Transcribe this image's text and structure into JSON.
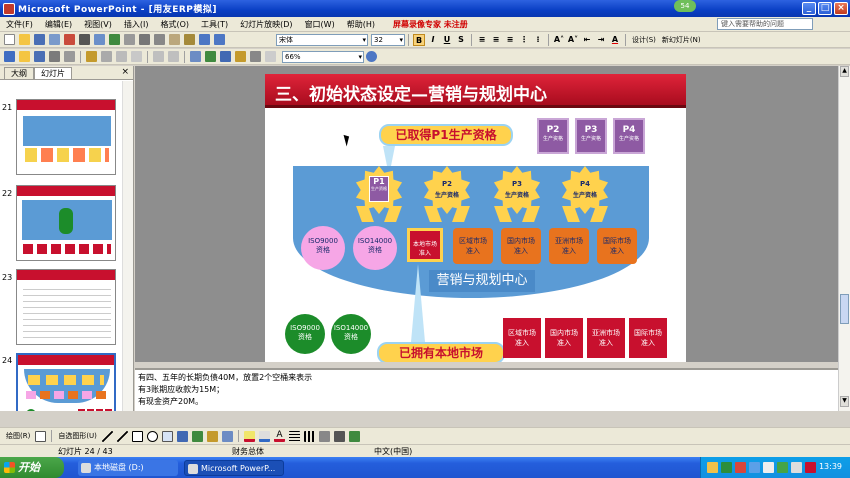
{
  "window": {
    "title": "Microsoft PowerPoint - [用友ERP模拟]",
    "badge": "54"
  },
  "menu": {
    "items": [
      "文件(F)",
      "编辑(E)",
      "视图(V)",
      "插入(I)",
      "格式(O)",
      "工具(T)",
      "幻灯片放映(D)",
      "窗口(W)",
      "帮助(H)"
    ],
    "watermark": "屏幕录像专家  未注册",
    "help_placeholder": "键入需要帮助的问题"
  },
  "format_toolbar": {
    "font": "宋体",
    "size": "32",
    "design": "设计(S)",
    "new_slide": "新幻灯片(N)"
  },
  "standard_toolbar": {
    "zoom": "66%"
  },
  "left_pane": {
    "tabs": [
      "大纲",
      "幻灯片"
    ],
    "thumbnails": [
      {
        "num": "21"
      },
      {
        "num": "22"
      },
      {
        "num": "23"
      },
      {
        "num": "24"
      }
    ]
  },
  "slide": {
    "title": "三、初始状态设定—营销与规划中心",
    "callout_top": "已取得P1生产资格",
    "callout_bottom": "已拥有本地市场",
    "panel_label": "营销与规划中心",
    "top_badges": [
      {
        "label": "P2",
        "sub": "生产资格"
      },
      {
        "label": "P3",
        "sub": "生产资格"
      },
      {
        "label": "P4",
        "sub": "生产资格"
      }
    ],
    "stars": [
      {
        "label": "P1",
        "sub": "生产资格"
      },
      {
        "label": "P2",
        "sub": "生产资格"
      },
      {
        "label": "P3",
        "sub": "生产资格"
      },
      {
        "label": "P4",
        "sub": "生产资格"
      }
    ],
    "iso_pink": [
      {
        "line1": "ISO9000",
        "line2": "资格"
      },
      {
        "line1": "ISO14000",
        "line2": "资格"
      }
    ],
    "markets_row": [
      {
        "line1": "本地市场",
        "line2": "准入"
      },
      {
        "line1": "区域市场",
        "line2": "准入"
      },
      {
        "line1": "国内市场",
        "line2": "准入"
      },
      {
        "line1": "亚洲市场",
        "line2": "准入"
      },
      {
        "line1": "国际市场",
        "line2": "准入"
      }
    ],
    "iso_green": [
      {
        "line1": "ISO9000",
        "line2": "资格"
      },
      {
        "line1": "ISO14000",
        "line2": "资格"
      }
    ],
    "markets_bottom": [
      {
        "line1": "区域市场",
        "line2": "准入"
      },
      {
        "line1": "国内市场",
        "line2": "准入"
      },
      {
        "line1": "亚洲市场",
        "line2": "准入"
      },
      {
        "line1": "国际市场",
        "line2": "准入"
      }
    ]
  },
  "notes": {
    "lines": [
      "有四、五年的长期负债40M，放置2个空桶来表示",
      "有3账期应收款为15M；",
      "有现金资产20M。"
    ]
  },
  "draw_toolbar": {
    "draw": "绘图(R)",
    "autoshapes": "自选图形(U)"
  },
  "status": {
    "slide": "幻灯片 24 / 43",
    "design": "财务总体",
    "lang": "中文(中国)"
  },
  "taskbar": {
    "start": "开始",
    "tasks": [
      "本地磁盘 (D:)",
      "Microsoft PowerP..."
    ],
    "time": "13:39"
  },
  "colors": {
    "accent_red": "#c8102e",
    "panel_blue": "#5b9bd5",
    "star_yellow": "#ffd24d",
    "market_orange": "#e8731e",
    "iso_pink": "#f6a6e6",
    "iso_green": "#1c8c2a"
  }
}
